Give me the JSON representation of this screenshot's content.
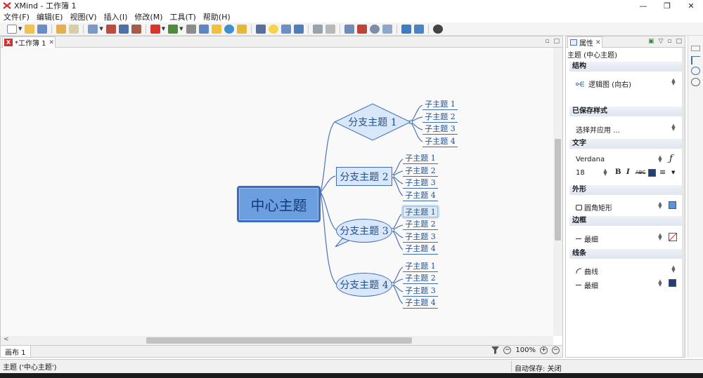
{
  "window": {
    "title": "XMind - 工作簿 1"
  },
  "menu": [
    "文件(F)",
    "编辑(E)",
    "视图(V)",
    "插入(I)",
    "修改(M)",
    "工具(T)",
    "帮助(H)"
  ],
  "editor": {
    "tab_label": "*工作簿 1",
    "sheet_tab": "画布 1",
    "zoom": "100%"
  },
  "mindmap": {
    "central": "中心主题",
    "branches": [
      {
        "label": "分支主题 1",
        "shape": "diamond",
        "subtopics": [
          "子主题 1",
          "子主题 2",
          "子主题 3",
          "子主题 4"
        ]
      },
      {
        "label": "分支主题 2",
        "shape": "rectangle",
        "subtopics": [
          "子主题 1",
          "子主题 2",
          "子主题 3",
          "子主题 4"
        ]
      },
      {
        "label": "分支主题 3",
        "shape": "callout-ellipse",
        "subtopics": [
          "子主题 1",
          "子主题 2",
          "子主题 3",
          "子主题 4"
        ]
      },
      {
        "label": "分支主题 4",
        "shape": "ellipse",
        "subtopics": [
          "子主题 1",
          "子主题 2",
          "子主题 3",
          "子主题 4"
        ]
      }
    ],
    "selected_subtopic": "子主题 1"
  },
  "properties": {
    "tab_label": "属性",
    "subtitle": "主题 (中心主题)",
    "structure": {
      "header": "结构",
      "value": "逻辑图 (向右)"
    },
    "saved_style": {
      "header": "已保存样式",
      "value": "选择并应用 ..."
    },
    "text": {
      "header": "文字",
      "font": "Verdana",
      "size": "18",
      "color": "#1f3f7a"
    },
    "shape": {
      "header": "外形",
      "value": "圆角矩形",
      "color": "#5c93d6"
    },
    "border": {
      "header": "边框",
      "value": "最细"
    },
    "line": {
      "header": "线条",
      "style": "曲线",
      "width": "最细",
      "color": "#1f3f7a"
    }
  },
  "statusbar": {
    "left": "主题 ('中心主题')",
    "autosave": "自动保存: 关闭"
  }
}
